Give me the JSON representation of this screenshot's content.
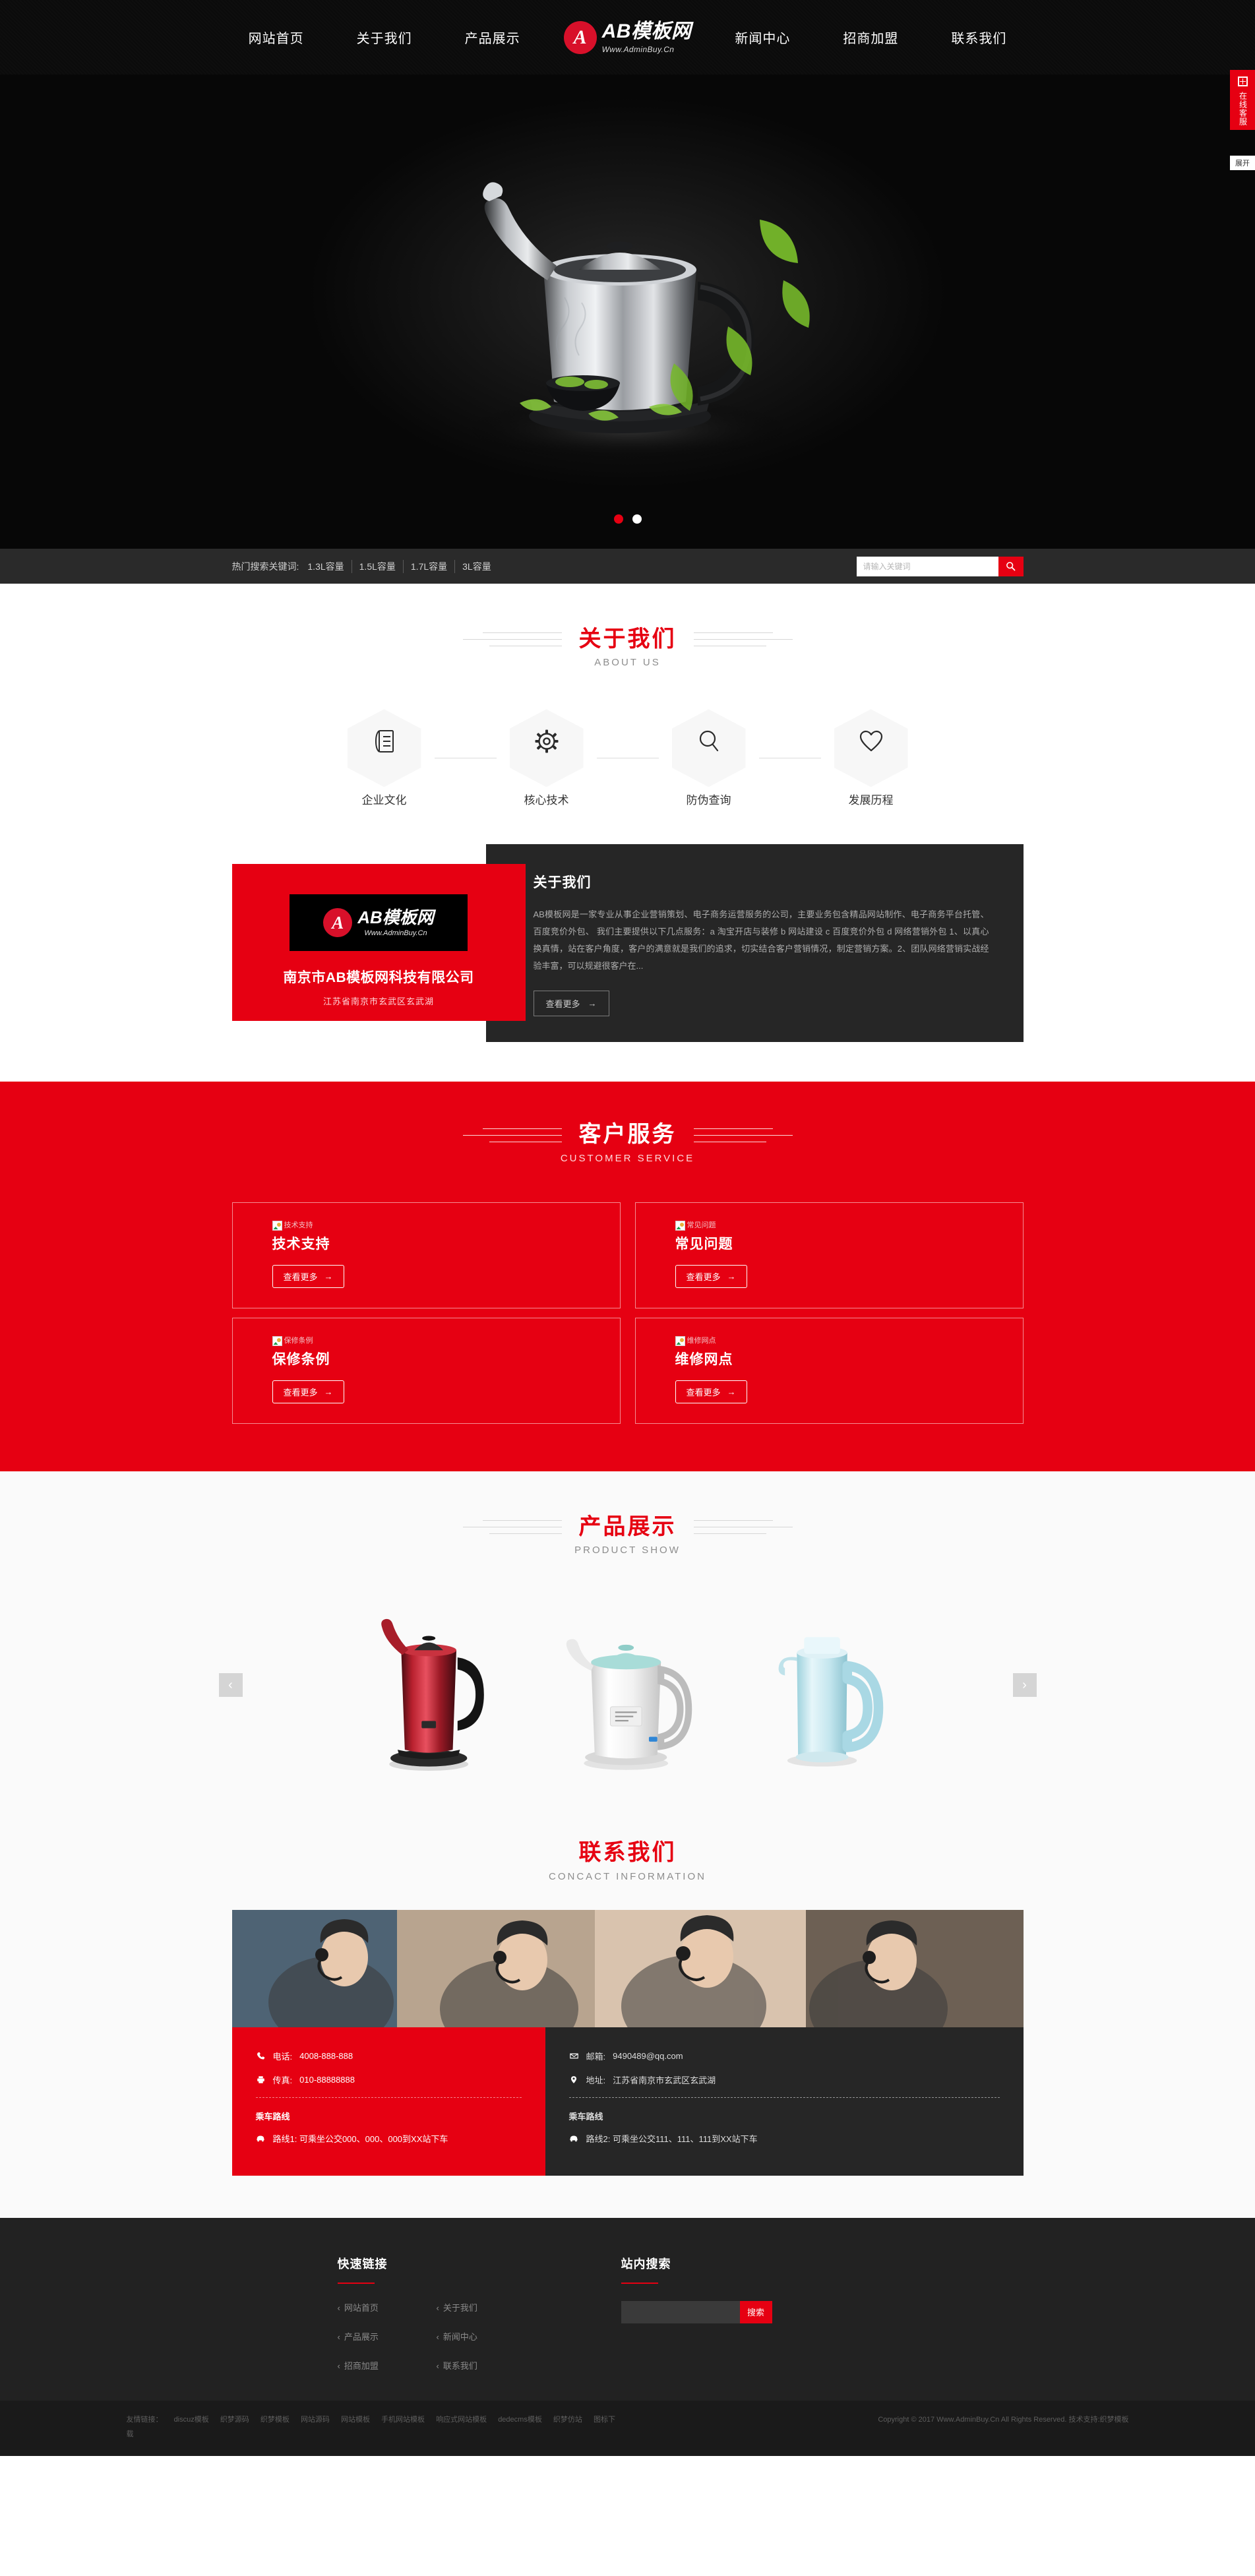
{
  "header": {
    "nav_left": [
      {
        "label": "网站首页"
      },
      {
        "label": "关于我们"
      },
      {
        "label": "产品展示"
      }
    ],
    "nav_right": [
      {
        "label": "新闻中心"
      },
      {
        "label": "招商加盟"
      },
      {
        "label": "联系我们"
      }
    ],
    "logo": {
      "mark": "A",
      "name": "AB模板网",
      "site": "Www.AdminBuy.Cn"
    }
  },
  "banner": {
    "dots": [
      "1",
      "2"
    ],
    "active_dot": 0
  },
  "searchbar": {
    "hot_label": "热门搜索关键词:",
    "keywords": [
      "1.3L容量",
      "1.5L容量",
      "1.7L容量",
      "3L容量"
    ],
    "placeholder": "请输入关键词",
    "value": "",
    "button_icon": "search-icon"
  },
  "about": {
    "title_cn": "关于我们",
    "title_en": "ABOUT US",
    "features": [
      {
        "label": "企业文化",
        "icon": "document-icon"
      },
      {
        "label": "核心技术",
        "icon": "gear-icon"
      },
      {
        "label": "防伪查询",
        "icon": "magnifier-icon"
      },
      {
        "label": "发展历程",
        "icon": "heart-icon"
      }
    ],
    "card": {
      "logo_mark": "A",
      "logo_name": "AB模板网",
      "logo_site": "Www.AdminBuy.Cn",
      "company": "南京市AB模板网科技有限公司",
      "address": "江苏省南京市玄武区玄武湖"
    },
    "panel": {
      "heading": "关于我们",
      "body": "AB模板网是一家专业从事企业营销策划、电子商务运营服务的公司，主要业务包含精品网站制作、电子商务平台托管、百度竞价外包、 我们主要提供以下几点服务：a 淘宝开店与装修 b 网站建设 c 百度竞价外包 d 网络营销外包 1、以真心换真情，站在客户角度，客户的满意就是我们的追求，切实结合客户营销情况，制定营销方案。2、团队网络营销实战经验丰富，可以规避很客户在...",
      "more_label": "查看更多",
      "more_arrow": "→"
    }
  },
  "customer_service": {
    "title_cn": "客户服务",
    "title_en": "CUSTOMER SERVICE",
    "cards": [
      {
        "alt": "技术支持",
        "title": "技术支持",
        "btn": "查看更多",
        "arrow": "→"
      },
      {
        "alt": "常见问题",
        "title": "常见问题",
        "btn": "查看更多",
        "arrow": "→"
      },
      {
        "alt": "保修条例",
        "title": "保修条例",
        "btn": "查看更多",
        "arrow": "→"
      },
      {
        "alt": "维修网点",
        "title": "维修网点",
        "btn": "查看更多",
        "arrow": "→"
      }
    ]
  },
  "products": {
    "title_cn": "产品展示",
    "title_en": "PRODUCT SHOW",
    "prev_icon": "chevron-left-icon",
    "next_icon": "chevron-right-icon",
    "items": [
      {
        "name": "红色电热水壶"
      },
      {
        "name": "白色电热水壶"
      },
      {
        "name": "蓝色电热水壶"
      }
    ]
  },
  "contact": {
    "title_cn": "联系我们",
    "title_en": "CONCACT INFORMATION",
    "left": {
      "phone_label": "电话:",
      "phone": "4008-888-888",
      "fax_label": "传真:",
      "fax": "010-88888888",
      "route_title": "乘车路线",
      "route": "路线1: 可乘坐公交000、000、000到XX站下车"
    },
    "right": {
      "email_label": "邮箱:",
      "email": "9490489@qq.com",
      "addr_label": "地址:",
      "addr": "江苏省南京市玄武区玄武湖",
      "route_title": "乘车路线",
      "route": "路线2: 可乘坐公交111、111、111到XX站下车"
    }
  },
  "footer": {
    "quick_title": "快速链接",
    "quick_links": [
      {
        "label": "网站首页"
      },
      {
        "label": "关于我们"
      },
      {
        "label": "产品展示"
      },
      {
        "label": "新闻中心"
      },
      {
        "label": "招商加盟"
      },
      {
        "label": "联系我们"
      }
    ],
    "search_title": "站内搜索",
    "search_value": "",
    "search_button": "搜索"
  },
  "copybar": {
    "friends_label": "友情链接：",
    "friends": [
      "discuz模板",
      "织梦源码",
      "织梦模板",
      "网站源码",
      "网站模板",
      "手机网站模板",
      "响应式网站模板",
      "dedecms模板",
      "织梦仿站",
      "图标下载"
    ],
    "copyright": "Copyright © 2017 Www.AdminBuy.Cn All Rights Reserved.   技术支持:织梦模板"
  },
  "side_widget": {
    "label": "在线客服",
    "expand": "展开",
    "icon": "plus-square-icon"
  },
  "colors": {
    "brand_red": "#e60012",
    "dark_panel": "#262626",
    "header_black": "#0b0b0b",
    "footer": "#222222"
  }
}
